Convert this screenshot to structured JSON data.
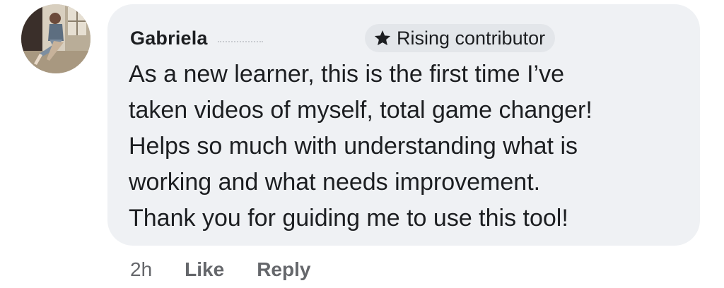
{
  "comment": {
    "author": "Gabriela",
    "badge": {
      "icon": "star-icon",
      "label": "Rising contributor"
    },
    "text": "As a new learner, this is the first time I’ve\ntaken videos of myself, total game changer!\nHelps so much with understanding what is\nworking and what needs improvement.\nThank you for guiding me to use this tool!",
    "timestamp": "2h",
    "actions": {
      "like_label": "Like",
      "reply_label": "Reply"
    }
  },
  "colors": {
    "bubble_background": "#eff1f4",
    "badge_background": "#e3e6ea",
    "primary_text": "#1c1e21",
    "secondary_text": "#65676b"
  }
}
